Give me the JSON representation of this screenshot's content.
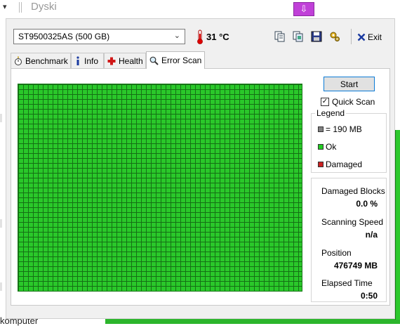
{
  "background": {
    "explorer_title": "Dyski",
    "bottom_text": "komputer"
  },
  "toolbar": {
    "drive": "ST9500325AS (500 GB)",
    "temperature": "31 °C",
    "exit_label": "Exit"
  },
  "tabs": [
    {
      "label": "Benchmark",
      "icon": "stopwatch-icon"
    },
    {
      "label": "Info",
      "icon": "info-icon"
    },
    {
      "label": "Health",
      "icon": "health-cross-icon"
    },
    {
      "label": "Error Scan",
      "icon": "magnifier-icon",
      "active": true
    }
  ],
  "scan": {
    "start_label": "Start",
    "quick_scan_label": "Quick Scan",
    "quick_scan_checked": true
  },
  "legend": {
    "title": "Legend",
    "block_size": "= 190 MB",
    "ok": "Ok",
    "damaged": "Damaged",
    "colors": {
      "block": "#808080",
      "ok": "#22cc22",
      "damaged": "#cc2222"
    }
  },
  "stats": {
    "damaged_blocks_label": "Damaged Blocks",
    "damaged_blocks_value": "0.0 %",
    "scanning_speed_label": "Scanning Speed",
    "scanning_speed_value": "n/a",
    "position_label": "Position",
    "position_value": "476749 MB",
    "elapsed_label": "Elapsed Time",
    "elapsed_value": "0:50"
  },
  "colors": {
    "scan_ok": "#2ac82a",
    "scan_grid_line": "#157015",
    "accent": "#0a7ad6"
  }
}
